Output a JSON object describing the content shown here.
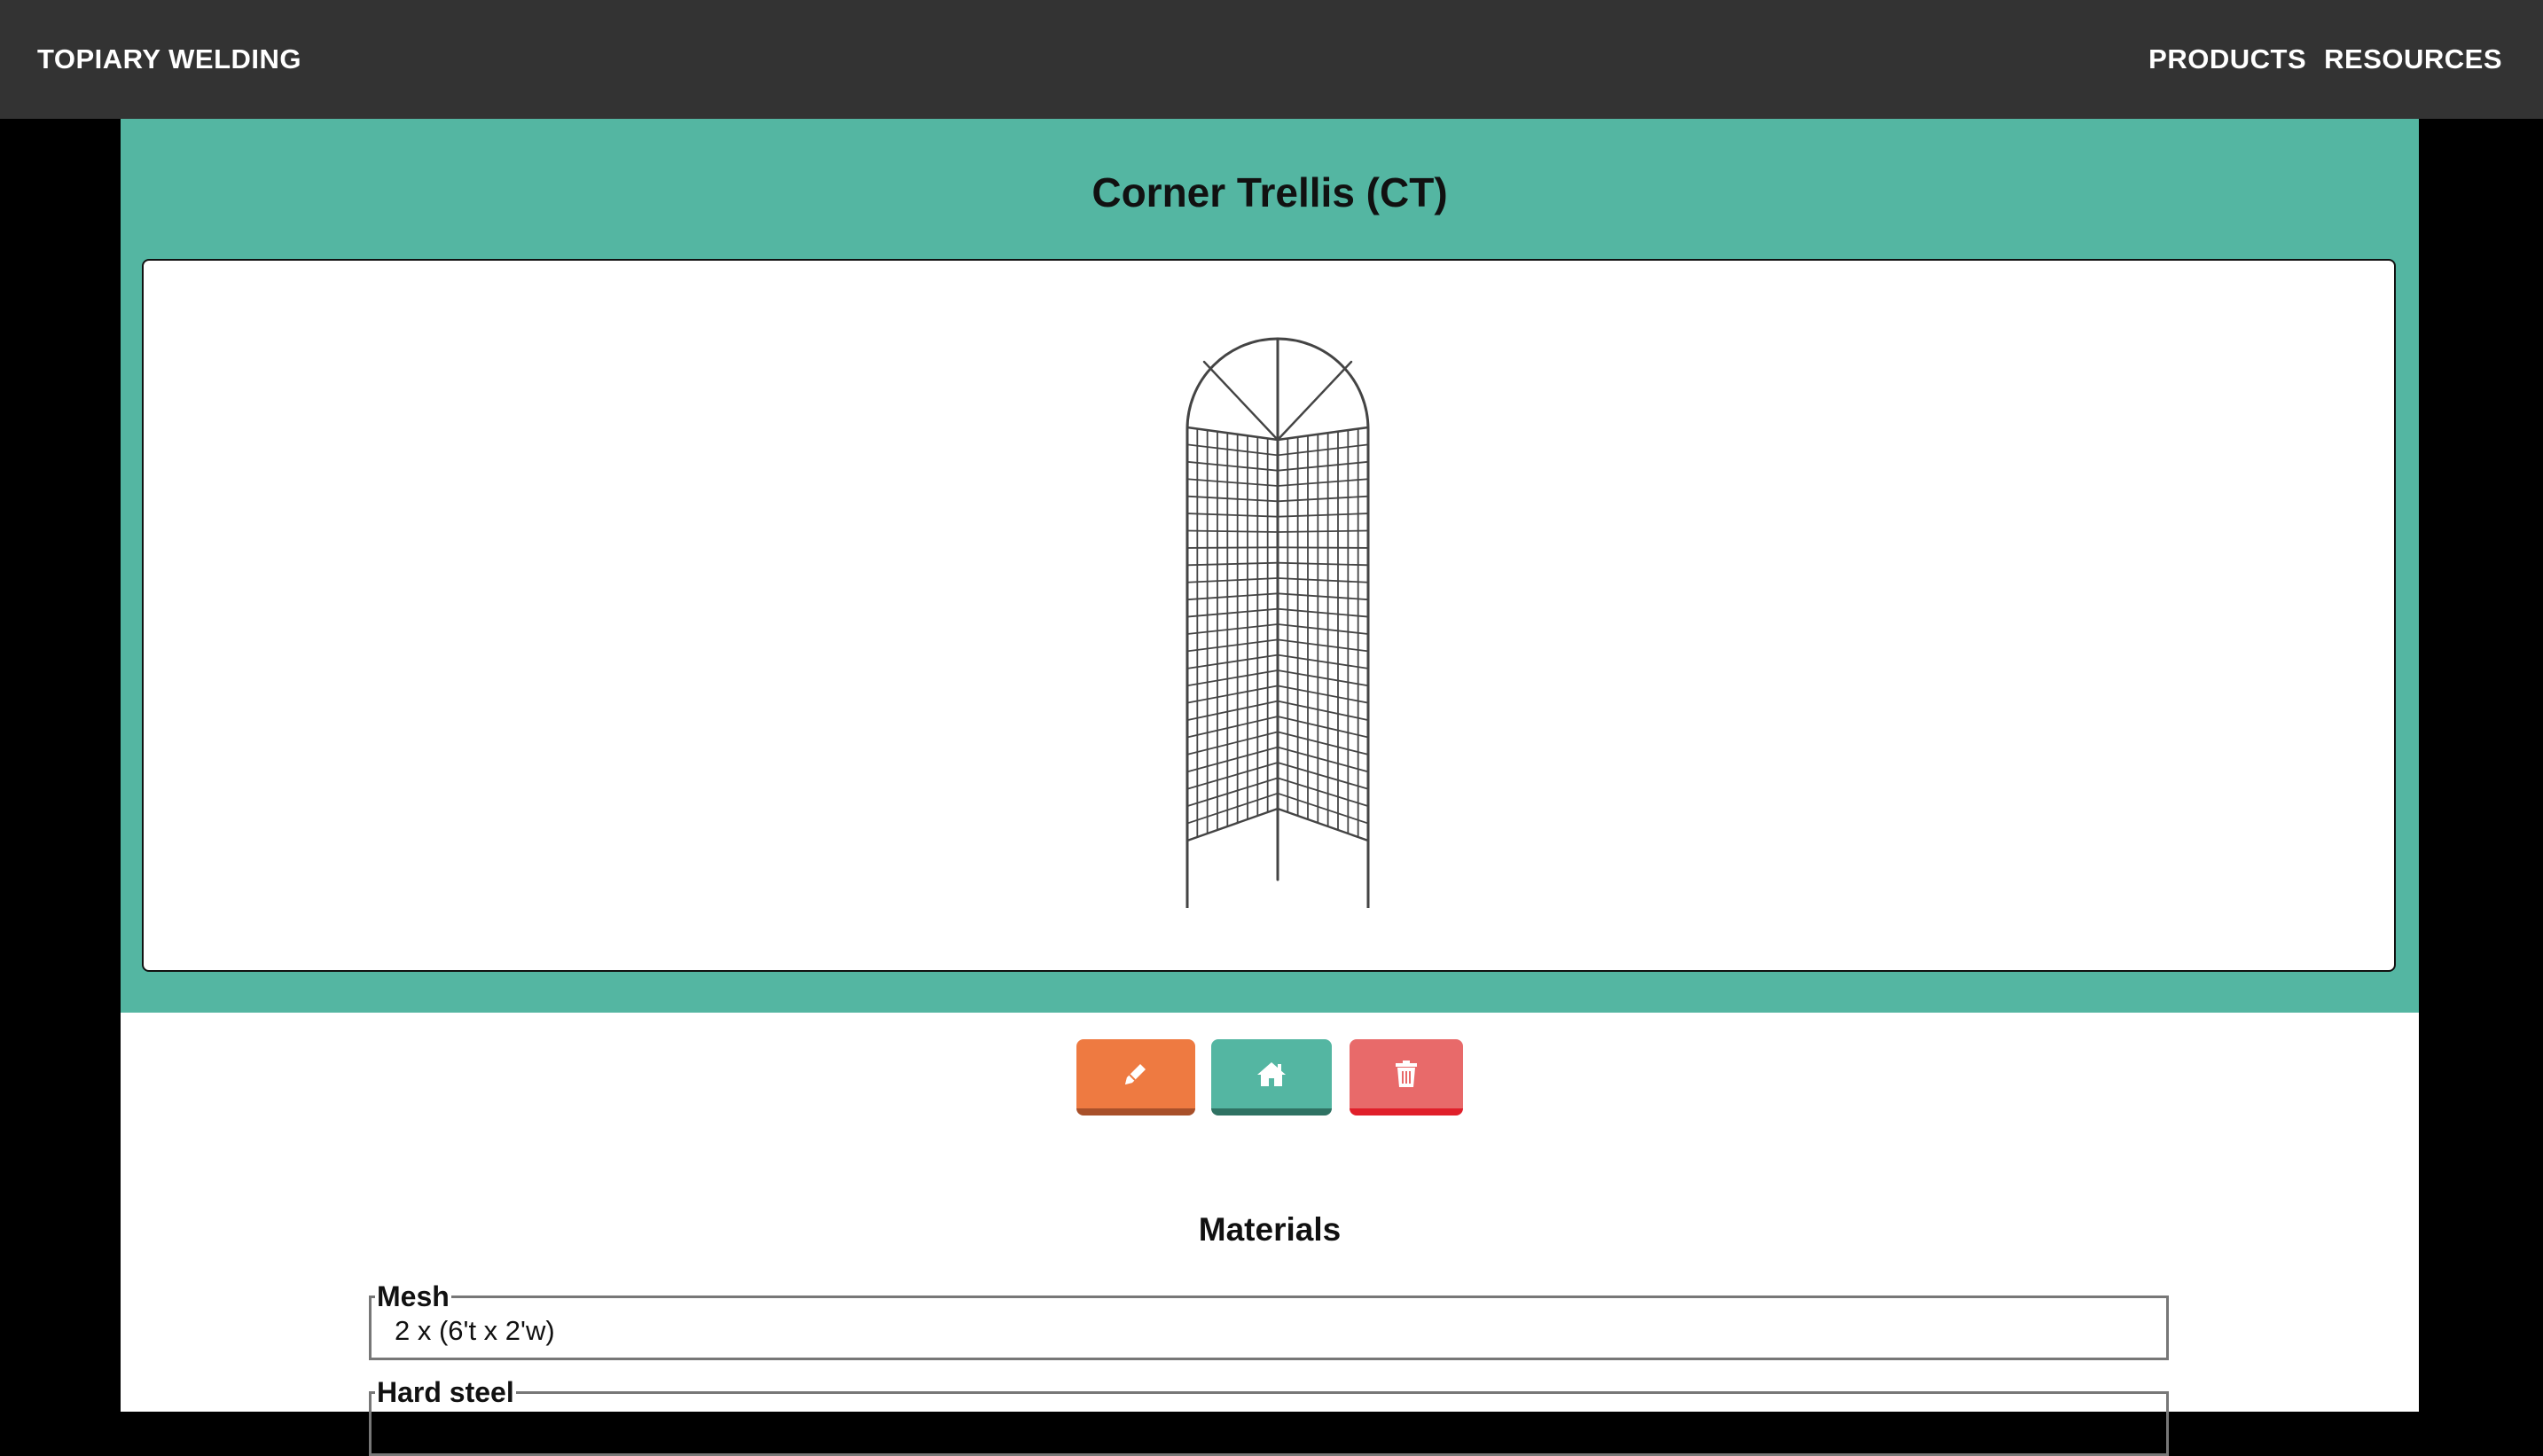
{
  "navbar": {
    "brand": "TOPIARY WELDING",
    "links": [
      {
        "label": "PRODUCTS"
      },
      {
        "label": "RESOURCES"
      }
    ]
  },
  "product": {
    "title": "Corner Trellis (CT)",
    "image_icon": "corner-trellis-drawing"
  },
  "actions": {
    "edit": {
      "icon": "pencil-icon",
      "color": "#ee7a41"
    },
    "home": {
      "icon": "home-icon",
      "color": "#54b6a2"
    },
    "delete": {
      "icon": "trash-icon",
      "color": "#e86a6a"
    }
  },
  "materials": {
    "heading": "Materials",
    "items": [
      {
        "name": "Mesh",
        "value": "2 x (6't x 2'w)"
      },
      {
        "name": "Hard steel",
        "value": ""
      }
    ]
  },
  "colors": {
    "topbar": "#333333",
    "accent": "#54b6a2",
    "edit": "#ee7a41",
    "delete": "#e86a6a"
  }
}
